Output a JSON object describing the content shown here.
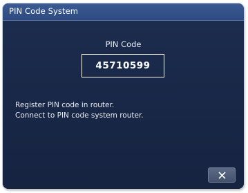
{
  "window": {
    "title": "PIN Code System"
  },
  "pin": {
    "label": "PIN Code",
    "value": "45710599"
  },
  "messages": [
    "Register PIN code in router.",
    "Connect to PIN code system router."
  ],
  "close_button": {
    "icon": "close-icon"
  },
  "colors": {
    "background": "#1b2a4a",
    "titlebar": "#2e4a80",
    "text": "#ffffff"
  }
}
